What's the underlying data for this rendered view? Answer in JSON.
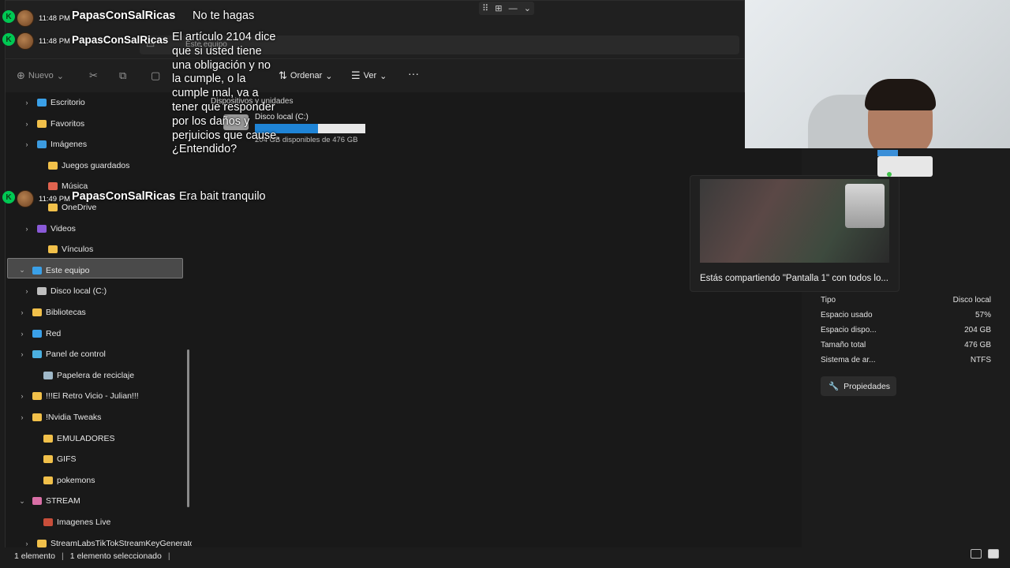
{
  "explorer": {
    "breadcrumb": "Este equipo",
    "toolbar": {
      "new_label": "Nuevo",
      "sort_label": "Ordenar",
      "view_label": "Ver",
      "more_label": "···"
    },
    "sidebar": [
      {
        "label": "Escritorio",
        "icon": "desktop-icon",
        "expand": "›"
      },
      {
        "label": "Favoritos",
        "icon": "folder-icon",
        "expand": "›"
      },
      {
        "label": "Imágenes",
        "icon": "pictures-icon",
        "expand": "›"
      },
      {
        "label": "Juegos guardados",
        "icon": "folder-icon",
        "expand": ""
      },
      {
        "label": "Música",
        "icon": "music-icon",
        "expand": ""
      },
      {
        "label": "OneDrive",
        "icon": "folder-icon",
        "expand": ""
      },
      {
        "label": "Videos",
        "icon": "videos-icon",
        "expand": "›"
      },
      {
        "label": "Vínculos",
        "icon": "folder-icon",
        "expand": ""
      },
      {
        "label": "Este equipo",
        "icon": "pc-icon",
        "expand": "⌄"
      },
      {
        "label": "Disco local (C:)",
        "icon": "drive-icon",
        "expand": "›"
      },
      {
        "label": "Bibliotecas",
        "icon": "folder-icon",
        "expand": "›"
      },
      {
        "label": "Red",
        "icon": "network-icon",
        "expand": "›"
      },
      {
        "label": "Panel de control",
        "icon": "control-panel-icon",
        "expand": "›"
      },
      {
        "label": "Papelera de reciclaje",
        "icon": "recycle-bin-icon",
        "expand": ""
      },
      {
        "label": "!!!El Retro Vicio - Julian!!!",
        "icon": "folder-icon",
        "expand": "›"
      },
      {
        "label": "!Nvidia Tweaks",
        "icon": "folder-icon",
        "expand": "›"
      },
      {
        "label": "EMULADORES",
        "icon": "folder-icon",
        "expand": ""
      },
      {
        "label": "GIFS",
        "icon": "folder-icon",
        "expand": ""
      },
      {
        "label": "pokemons",
        "icon": "folder-icon",
        "expand": ""
      },
      {
        "label": "STREAM",
        "icon": "stream-icon",
        "expand": "⌄"
      },
      {
        "label": "Imagenes Live",
        "icon": "image-icon",
        "expand": ""
      },
      {
        "label": "StreamLabsTikTokStreamKeyGenerato",
        "icon": "folder-icon",
        "expand": "›"
      }
    ],
    "main": {
      "group_header": "Dispositivos y unidades",
      "drive": {
        "name": "Disco local (C:)",
        "free_text": "204 GB disponibles de 476 GB",
        "used_fraction": 0.57
      }
    },
    "details": {
      "rows": [
        {
          "label": "Tipo",
          "value": "Disco local"
        },
        {
          "label": "Espacio usado",
          "value": "57%"
        },
        {
          "label": "Espacio dispo...",
          "value": "204 GB"
        },
        {
          "label": "Tamaño total",
          "value": "476 GB"
        },
        {
          "label": "Sistema de ar...",
          "value": "NTFS"
        }
      ],
      "properties_label": "Propiedades"
    },
    "status": {
      "count": "1 elemento",
      "selected": "1 elemento seleccionado"
    }
  },
  "share_overlay": {
    "text": "Estás compartiendo \"Pantalla 1\" con todos lo..."
  },
  "chat": [
    {
      "time": "11:48 PM",
      "user": "PapasConSalRicas",
      "message": "No te hagas"
    },
    {
      "time": "11:48 PM",
      "user": "PapasConSalRicas",
      "message": "El artículo 2104 dice que si usted tiene una obligación y no la cumple, o la cumple mal, va a tener que responder por los daños y perjuicios que cause. ¿Entendido?"
    },
    {
      "time": "11:49 PM",
      "user": "PapasConSalRicas",
      "message": "Era bait tranquilo"
    }
  ],
  "colors": {
    "accent": "#1f84d6",
    "chat_badge": "#00c853",
    "background": "#191919"
  }
}
